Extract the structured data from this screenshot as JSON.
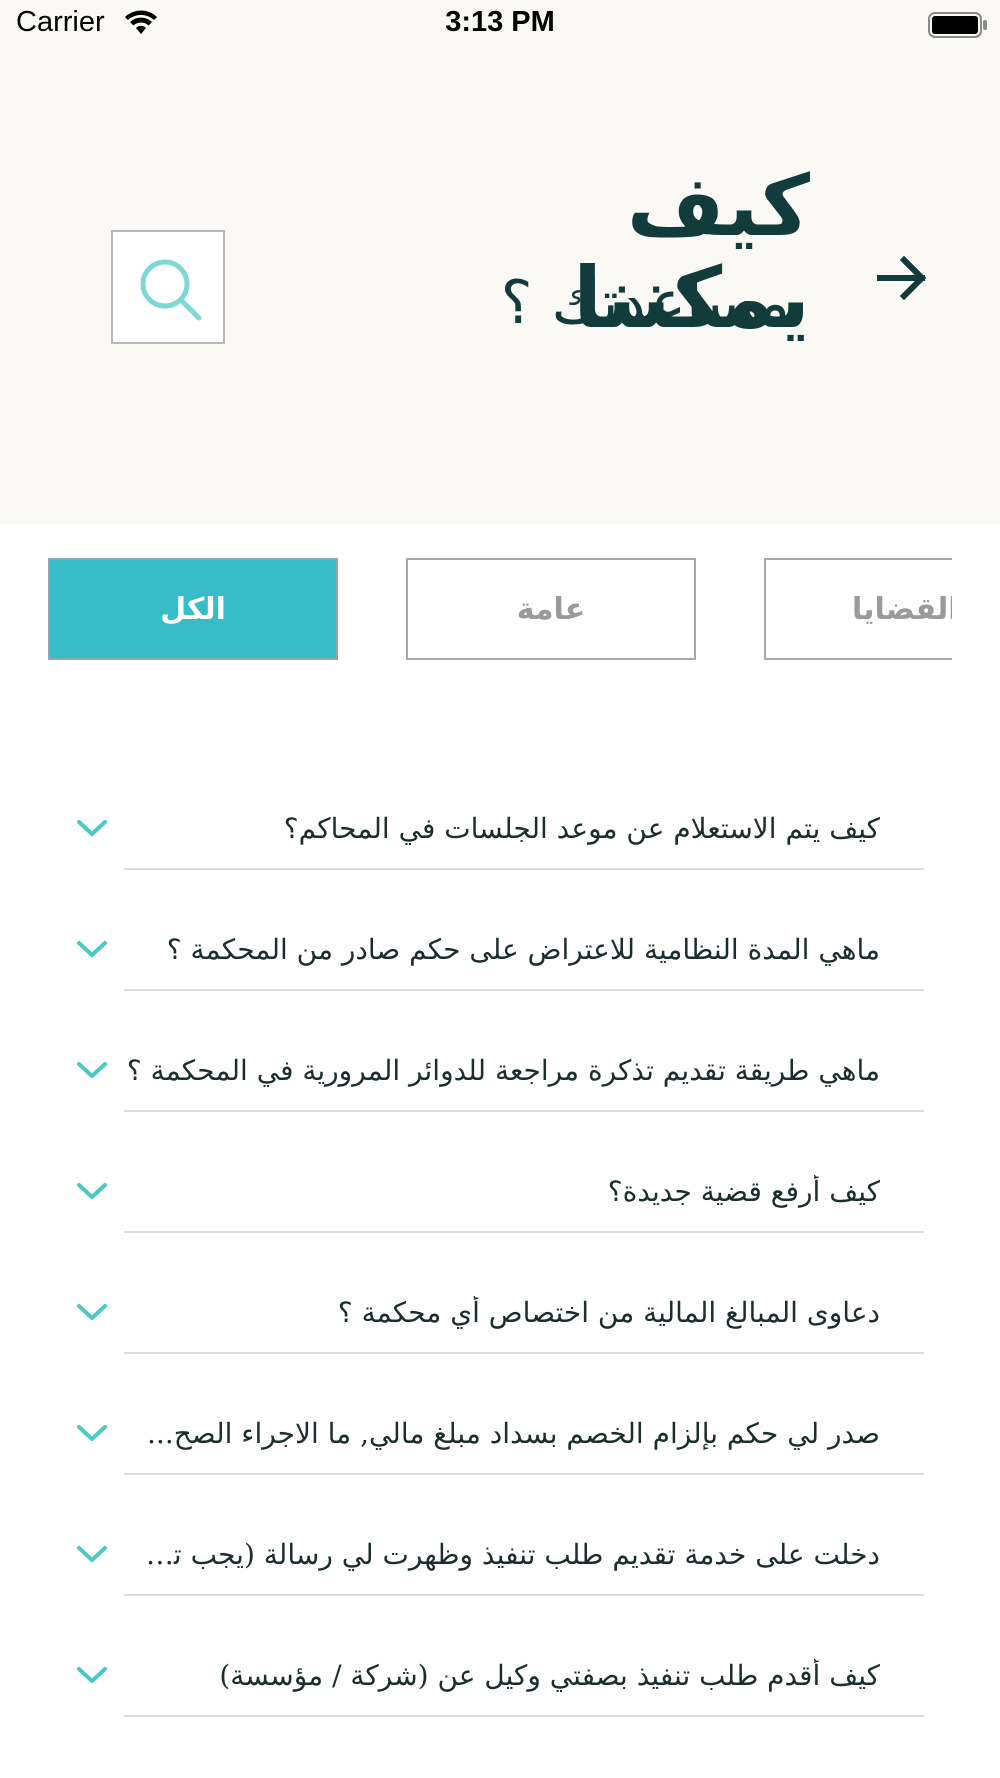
{
  "status_bar": {
    "carrier": "Carrier",
    "time": "3:13 PM"
  },
  "header": {
    "title_line1": "كيف يمكننا",
    "title_line2": "مساعدتك ؟"
  },
  "tabs": [
    {
      "label": "الكل",
      "active": true
    },
    {
      "label": "عامة",
      "active": false
    },
    {
      "label": "القضايا",
      "active": false
    }
  ],
  "faq": [
    {
      "question": "كيف يتم الاستعلام عن موعد الجلسات في المحاكم؟"
    },
    {
      "question": "ماهي المدة النظامية للاعتراض على حكم صادر من المحكمة ؟"
    },
    {
      "question": "ماهي طريقة تقديم تذكرة مراجعة للدوائر المرورية في المحكمة ؟"
    },
    {
      "question": "كيف أرفع قضية جديدة؟"
    },
    {
      "question": "دعاوى المبالغ المالية من اختصاص أي محكمة ؟"
    },
    {
      "question": "صدر لي حكم بإلزام الخصم بسداد مبلغ مالي, ما الاجراء الصح..."
    },
    {
      "question": "دخلت على خدمة تقديم طلب تنفيذ وظهرت لي رسالة (يجب تسجي..."
    },
    {
      "question": "كيف أقدم طلب تنفيذ بصفتي وكيل عن (شركة / مؤسسة)"
    }
  ],
  "colors": {
    "accent": "#38bcc8",
    "title": "#123c3c",
    "header_bg": "#faf9f6",
    "chevron": "#4cc9c5"
  }
}
